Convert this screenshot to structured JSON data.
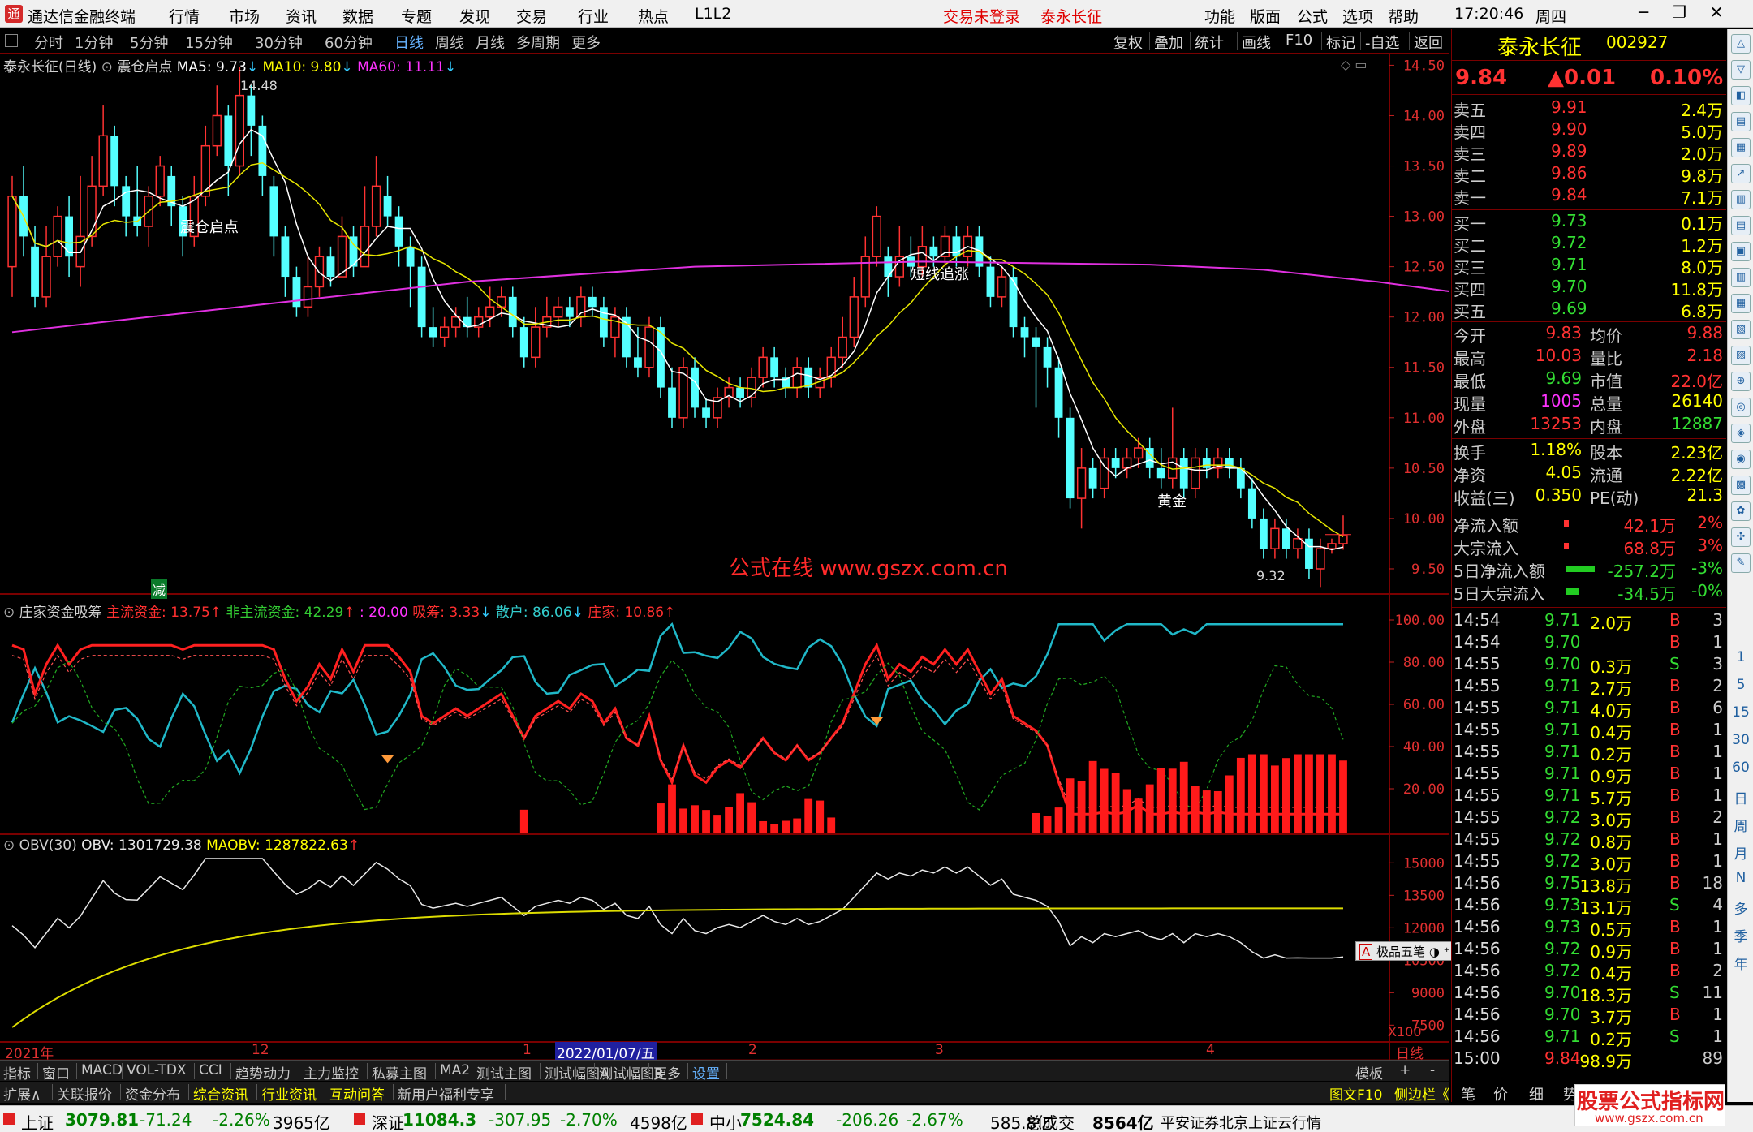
{
  "app": {
    "title": "通达信金融终端",
    "menu": [
      "行情",
      "市场",
      "资讯",
      "数据",
      "专题",
      "发现",
      "交易",
      "行业",
      "热点",
      "L1L2"
    ],
    "trade_status": "交易未登录",
    "stock_title": "泰永长征",
    "right_menu": [
      "功能",
      "版面",
      "公式",
      "选项",
      "帮助"
    ],
    "time": "17:20:46",
    "weekday": "周四"
  },
  "period_tabs": [
    "分时",
    "1分钟",
    "5分钟",
    "15分钟",
    "30分钟",
    "60分钟",
    "日线",
    "周线",
    "月线",
    "多周期",
    "更多"
  ],
  "active_period": "日线",
  "tool_buttons": [
    "复权",
    "叠加",
    "统计",
    "画线",
    "F10",
    "标记",
    "-自选",
    "返回"
  ],
  "stock": {
    "name": "泰永长征",
    "code": "002927",
    "price": "9.84",
    "change": "▲0.01",
    "pct": "0.10%"
  },
  "main_panel": {
    "header": "泰永长征(日线)",
    "formula": "震仓启点",
    "ma5": "MA5: 9.73",
    "ma10": "MA10: 9.80",
    "ma60": "MA60: 11.11",
    "annotations": {
      "high": "14.48",
      "low": "9.32",
      "a1": "震仓启点",
      "a2": "短线追涨",
      "a3": "黄金",
      "watermark": "公式在线  www.gszx.com.cn",
      "small": "减"
    },
    "axis": [
      "14.50",
      "14.00",
      "13.50",
      "13.00",
      "12.50",
      "12.00",
      "11.50",
      "11.00",
      "10.50",
      "10.00",
      "9.50"
    ]
  },
  "ind1": {
    "header": "庄家资金吸筹",
    "a": "主流资金: 13.75",
    "b": "非主流资金: 42.29",
    "c": ": 20.00",
    "d": "吸筹: 3.33",
    "e": "散户: 86.06",
    "f": "庄家: 10.86",
    "axis": [
      "100.00",
      "80.00",
      "60.00",
      "40.00",
      "20.00"
    ]
  },
  "ind2": {
    "header": "OBV(30)",
    "obv": "OBV: 1301729.38",
    "maobv": "MAOBV: 1287822.63",
    "axis": [
      "15000",
      "13500",
      "12000",
      "10500",
      "9000",
      "7500"
    ],
    "unit": "X100"
  },
  "x_axis": {
    "labels": [
      "2021年",
      "12",
      "1",
      "2022/01/07/五",
      "2",
      "3",
      "4"
    ],
    "period": "日线"
  },
  "order_book": {
    "asks": [
      {
        "label": "卖五",
        "price": "9.91",
        "vol": "2.4万"
      },
      {
        "label": "卖四",
        "price": "9.90",
        "vol": "5.0万"
      },
      {
        "label": "卖三",
        "price": "9.89",
        "vol": "2.0万"
      },
      {
        "label": "卖二",
        "price": "9.86",
        "vol": "9.8万"
      },
      {
        "label": "卖一",
        "price": "9.84",
        "vol": "7.1万"
      }
    ],
    "bids": [
      {
        "label": "买一",
        "price": "9.73",
        "vol": "0.1万"
      },
      {
        "label": "买二",
        "price": "9.72",
        "vol": "1.2万"
      },
      {
        "label": "买三",
        "price": "9.71",
        "vol": "8.0万"
      },
      {
        "label": "买四",
        "price": "9.70",
        "vol": "11.8万"
      },
      {
        "label": "买五",
        "price": "9.69",
        "vol": "6.8万"
      }
    ]
  },
  "quote_stats": [
    {
      "k1": "今开",
      "v1": "9.83",
      "k2": "均价",
      "v2": "9.88"
    },
    {
      "k1": "最高",
      "v1": "10.03",
      "k2": "量比",
      "v2": "2.18"
    },
    {
      "k1": "最低",
      "v1": "9.69",
      "k2": "市值",
      "v2": "22.0亿"
    },
    {
      "k1": "现量",
      "v1": "1005",
      "k2": "总量",
      "v2": "26140"
    },
    {
      "k1": "外盘",
      "v1": "13253",
      "k2": "内盘",
      "v2": "12887"
    }
  ],
  "fundamentals": [
    {
      "k1": "换手",
      "v1": "1.18%",
      "k2": "股本",
      "v2": "2.23亿"
    },
    {
      "k1": "净资",
      "v1": "4.05",
      "k2": "流通",
      "v2": "2.22亿"
    },
    {
      "k1": "收益(三)",
      "v1": "0.350",
      "k2": "PE(动)",
      "v2": "21.3"
    }
  ],
  "flows": [
    {
      "k": "净流入额",
      "v": "42.1万",
      "p": "2%"
    },
    {
      "k": "大宗流入",
      "v": "68.8万",
      "p": "3%"
    },
    {
      "k": "5日净流入额",
      "v": "-257.2万",
      "p": "-3%"
    },
    {
      "k": "5日大宗流入",
      "v": "-34.5万",
      "p": "-0%"
    }
  ],
  "ticks": [
    {
      "t": "14:54",
      "p": "9.71",
      "v": "2.0万",
      "s": "B",
      "n": "3"
    },
    {
      "t": "14:54",
      "p": "9.70",
      "v": "",
      "s": "B",
      "n": "1"
    },
    {
      "t": "14:55",
      "p": "9.70",
      "v": "0.3万",
      "s": "S",
      "n": "3"
    },
    {
      "t": "14:55",
      "p": "9.71",
      "v": "2.7万",
      "s": "B",
      "n": "2"
    },
    {
      "t": "14:55",
      "p": "9.71",
      "v": "4.0万",
      "s": "B",
      "n": "6"
    },
    {
      "t": "14:55",
      "p": "9.71",
      "v": "0.4万",
      "s": "B",
      "n": "1"
    },
    {
      "t": "14:55",
      "p": "9.71",
      "v": "0.2万",
      "s": "B",
      "n": "1"
    },
    {
      "t": "14:55",
      "p": "9.71",
      "v": "0.9万",
      "s": "B",
      "n": "1"
    },
    {
      "t": "14:55",
      "p": "9.71",
      "v": "5.7万",
      "s": "B",
      "n": "1"
    },
    {
      "t": "14:55",
      "p": "9.72",
      "v": "3.0万",
      "s": "B",
      "n": "2"
    },
    {
      "t": "14:55",
      "p": "9.72",
      "v": "0.8万",
      "s": "B",
      "n": "1"
    },
    {
      "t": "14:55",
      "p": "9.72",
      "v": "3.0万",
      "s": "B",
      "n": "1"
    },
    {
      "t": "14:56",
      "p": "9.75",
      "v": "13.8万",
      "s": "B",
      "n": "18"
    },
    {
      "t": "14:56",
      "p": "9.73",
      "v": "13.1万",
      "s": "S",
      "n": "4"
    },
    {
      "t": "14:56",
      "p": "9.73",
      "v": "0.5万",
      "s": "B",
      "n": "1"
    },
    {
      "t": "14:56",
      "p": "9.72",
      "v": "0.9万",
      "s": "B",
      "n": "1"
    },
    {
      "t": "14:56",
      "p": "9.72",
      "v": "0.4万",
      "s": "B",
      "n": "2"
    },
    {
      "t": "14:56",
      "p": "9.70",
      "v": "18.3万",
      "s": "S",
      "n": "11"
    },
    {
      "t": "14:56",
      "p": "9.70",
      "v": "3.7万",
      "s": "B",
      "n": "1"
    },
    {
      "t": "14:56",
      "p": "9.71",
      "v": "0.2万",
      "s": "S",
      "n": "1"
    },
    {
      "t": "15:00",
      "p": "9.84",
      "v": "98.9万",
      "s": "",
      "n": "89"
    }
  ],
  "panel_tabs": [
    "指标",
    "窗口",
    "MACD",
    "VOL-TDX",
    "CCI",
    "趋势动力",
    "主力监控",
    "私募主图",
    "MA2",
    "测试主图",
    "测试幅图A",
    "测试幅图B",
    "更多",
    "设置"
  ],
  "panel_right": [
    "模板",
    "+",
    "-"
  ],
  "info_tabs": [
    "扩展∧",
    "关联报价",
    "资金分布",
    "综合资讯",
    "行业资讯",
    "互动问答",
    "新用户福利专享"
  ],
  "info_right": [
    "图文F10",
    "侧边栏《",
    "笔",
    "价",
    "细",
    "势"
  ],
  "mini_toolbar": "极品五笔",
  "vtool_text": [
    "1",
    "5",
    "15",
    "30",
    "60",
    "日",
    "周",
    "月",
    "N",
    "多",
    "季",
    "年"
  ],
  "index_bar": [
    {
      "name": "上证",
      "val": "3079.81",
      "chg": "-71.24",
      "pct": "-2.26%",
      "amt": "3965亿"
    },
    {
      "name": "深证",
      "val": "11084.3",
      "chg": "-307.95",
      "pct": "-2.70%",
      "amt": "4598亿"
    },
    {
      "name": "中小",
      "val": "7524.84",
      "chg": "-206.26",
      "pct": "-2.67%",
      "amt": "585.8亿"
    }
  ],
  "total_label": "总成交",
  "total_val": "8564亿",
  "broker": "平安证券北京上证云行情",
  "logo_text": "股票公式指标网",
  "logo_url": "www.gszx.com.cn",
  "chart_data": {
    "type": "candlestick",
    "ylim": [
      9.25,
      14.6
    ],
    "ma60": [
      [
        0,
        11.85
      ],
      [
        20,
        12.1
      ],
      [
        40,
        12.35
      ],
      [
        60,
        12.5
      ],
      [
        80,
        12.55
      ],
      [
        100,
        12.52
      ],
      [
        110,
        12.47
      ],
      [
        120,
        12.35
      ],
      [
        140,
        12.05
      ],
      [
        150,
        11.8
      ],
      [
        160,
        11.6
      ],
      [
        175,
        11.3
      ]
    ],
    "candles": [
      [
        12.5,
        13.2,
        13.4,
        12.2
      ],
      [
        13.2,
        12.8,
        13.5,
        12.6
      ],
      [
        12.7,
        12.2,
        12.9,
        12.1
      ],
      [
        12.2,
        12.6,
        12.9,
        12.1
      ],
      [
        12.6,
        13.0,
        13.1,
        12.5
      ],
      [
        13.0,
        12.6,
        13.2,
        12.4
      ],
      [
        12.5,
        12.8,
        13.4,
        12.3
      ],
      [
        12.8,
        13.3,
        13.6,
        12.7
      ],
      [
        13.3,
        13.8,
        14.1,
        13.2
      ],
      [
        13.8,
        13.3,
        13.9,
        13.1
      ],
      [
        13.3,
        13.0,
        13.4,
        12.8
      ],
      [
        13.0,
        12.9,
        13.5,
        12.8
      ],
      [
        12.9,
        13.2,
        13.3,
        12.7
      ],
      [
        13.2,
        13.5,
        13.6,
        13.1
      ],
      [
        13.4,
        13.1,
        13.5,
        12.9
      ],
      [
        13.1,
        12.8,
        13.2,
        12.6
      ],
      [
        12.8,
        13.2,
        13.4,
        12.7
      ],
      [
        13.2,
        13.7,
        13.9,
        13.1
      ],
      [
        13.7,
        14.0,
        14.3,
        13.6
      ],
      [
        14.0,
        13.5,
        14.1,
        13.2
      ],
      [
        13.5,
        14.2,
        14.48,
        13.4
      ],
      [
        14.2,
        13.9,
        14.3,
        13.6
      ],
      [
        13.9,
        13.4,
        14.0,
        13.2
      ],
      [
        13.3,
        12.8,
        13.4,
        12.6
      ],
      [
        12.8,
        12.4,
        12.9,
        12.2
      ],
      [
        12.4,
        12.1,
        12.5,
        12.0
      ],
      [
        12.1,
        12.3,
        12.6,
        12.0
      ],
      [
        12.3,
        12.6,
        12.7,
        12.2
      ],
      [
        12.6,
        12.4,
        12.7,
        12.3
      ],
      [
        12.4,
        12.8,
        13.0,
        12.4
      ],
      [
        12.8,
        12.5,
        12.9,
        12.4
      ],
      [
        12.5,
        12.9,
        13.3,
        12.5
      ],
      [
        12.9,
        13.3,
        13.6,
        12.8
      ],
      [
        13.2,
        13.0,
        13.4,
        12.9
      ],
      [
        13.0,
        12.7,
        13.1,
        12.5
      ],
      [
        12.7,
        12.5,
        12.8,
        12.1
      ],
      [
        12.5,
        11.9,
        12.6,
        11.8
      ],
      [
        11.9,
        11.8,
        12.1,
        11.7
      ],
      [
        11.8,
        11.9,
        12.0,
        11.7
      ],
      [
        11.9,
        12.0,
        12.1,
        11.8
      ],
      [
        12.0,
        11.9,
        12.2,
        11.8
      ],
      [
        11.9,
        12.0,
        12.1,
        11.8
      ],
      [
        12.0,
        12.1,
        12.3,
        11.9
      ],
      [
        12.1,
        12.2,
        12.3,
        12.0
      ],
      [
        12.2,
        11.9,
        12.3,
        11.8
      ],
      [
        11.9,
        11.6,
        12.0,
        11.5
      ],
      [
        11.6,
        11.9,
        12.1,
        11.5
      ],
      [
        11.9,
        12.0,
        12.2,
        11.8
      ],
      [
        12.0,
        12.1,
        12.2,
        11.9
      ],
      [
        12.1,
        12.0,
        12.2,
        11.9
      ],
      [
        12.0,
        12.2,
        12.3,
        11.9
      ],
      [
        12.2,
        12.1,
        12.3,
        12.0
      ],
      [
        12.1,
        11.8,
        12.2,
        11.7
      ],
      [
        11.8,
        12.0,
        12.1,
        11.6
      ],
      [
        12.0,
        11.6,
        12.1,
        11.5
      ],
      [
        11.6,
        11.5,
        11.9,
        11.4
      ],
      [
        11.5,
        11.9,
        12.0,
        11.4
      ],
      [
        11.9,
        11.3,
        12.0,
        11.2
      ],
      [
        11.3,
        11.0,
        11.5,
        10.9
      ],
      [
        11.0,
        11.5,
        11.6,
        10.9
      ],
      [
        11.5,
        11.1,
        11.6,
        11.0
      ],
      [
        11.1,
        11.0,
        11.2,
        10.9
      ],
      [
        11.0,
        11.2,
        11.3,
        10.9
      ],
      [
        11.2,
        11.3,
        11.4,
        11.1
      ],
      [
        11.3,
        11.2,
        11.4,
        11.1
      ],
      [
        11.2,
        11.4,
        11.5,
        11.1
      ],
      [
        11.4,
        11.6,
        11.7,
        11.3
      ],
      [
        11.6,
        11.4,
        11.7,
        11.3
      ],
      [
        11.4,
        11.3,
        11.5,
        11.2
      ],
      [
        11.3,
        11.5,
        11.6,
        11.2
      ],
      [
        11.5,
        11.3,
        11.6,
        11.2
      ],
      [
        11.3,
        11.4,
        11.5,
        11.2
      ],
      [
        11.4,
        11.6,
        11.7,
        11.3
      ],
      [
        11.6,
        11.8,
        12.0,
        11.5
      ],
      [
        11.8,
        12.2,
        12.4,
        11.7
      ],
      [
        12.2,
        12.6,
        12.8,
        12.1
      ],
      [
        12.6,
        13.0,
        13.1,
        12.5
      ],
      [
        12.6,
        12.4,
        12.7,
        12.2
      ],
      [
        12.4,
        12.6,
        12.9,
        12.3
      ],
      [
        12.6,
        12.5,
        12.8,
        12.4
      ],
      [
        12.5,
        12.7,
        12.9,
        12.4
      ],
      [
        12.7,
        12.6,
        12.8,
        12.5
      ],
      [
        12.6,
        12.8,
        12.9,
        12.5
      ],
      [
        12.8,
        12.6,
        12.9,
        12.5
      ],
      [
        12.6,
        12.8,
        12.9,
        12.5
      ],
      [
        12.8,
        12.5,
        12.9,
        12.4
      ],
      [
        12.5,
        12.2,
        12.6,
        12.1
      ],
      [
        12.2,
        12.4,
        12.5,
        12.1
      ],
      [
        12.4,
        11.9,
        12.5,
        11.8
      ],
      [
        11.9,
        11.8,
        12.0,
        11.6
      ],
      [
        11.8,
        11.7,
        11.9,
        11.1
      ],
      [
        11.7,
        11.5,
        11.8,
        11.3
      ],
      [
        11.5,
        11.0,
        11.6,
        10.8
      ],
      [
        11.0,
        10.2,
        11.1,
        10.1
      ],
      [
        10.2,
        10.5,
        10.7,
        9.9
      ],
      [
        10.5,
        10.3,
        10.6,
        10.2
      ],
      [
        10.3,
        10.6,
        10.7,
        10.2
      ],
      [
        10.6,
        10.5,
        10.7,
        10.4
      ],
      [
        10.5,
        10.6,
        10.7,
        10.4
      ],
      [
        10.6,
        10.7,
        10.8,
        10.5
      ],
      [
        10.7,
        10.5,
        10.8,
        10.4
      ],
      [
        10.5,
        10.4,
        10.7,
        10.3
      ],
      [
        10.4,
        10.6,
        11.1,
        10.3
      ],
      [
        10.6,
        10.3,
        10.7,
        10.2
      ],
      [
        10.3,
        10.6,
        10.7,
        10.2
      ],
      [
        10.6,
        10.5,
        10.7,
        10.4
      ],
      [
        10.5,
        10.6,
        10.7,
        10.4
      ],
      [
        10.6,
        10.5,
        10.7,
        10.4
      ],
      [
        10.5,
        10.3,
        10.6,
        10.2
      ],
      [
        10.3,
        10.0,
        10.4,
        9.9
      ],
      [
        10.0,
        9.7,
        10.1,
        9.6
      ],
      [
        9.7,
        9.9,
        10.0,
        9.6
      ],
      [
        9.9,
        9.7,
        10.0,
        9.6
      ],
      [
        9.7,
        9.8,
        9.9,
        9.6
      ],
      [
        9.8,
        9.5,
        9.9,
        9.4
      ],
      [
        9.5,
        9.7,
        9.8,
        9.32
      ],
      [
        9.7,
        9.75,
        9.8,
        9.65
      ],
      [
        9.75,
        9.83,
        10.03,
        9.69
      ]
    ]
  }
}
